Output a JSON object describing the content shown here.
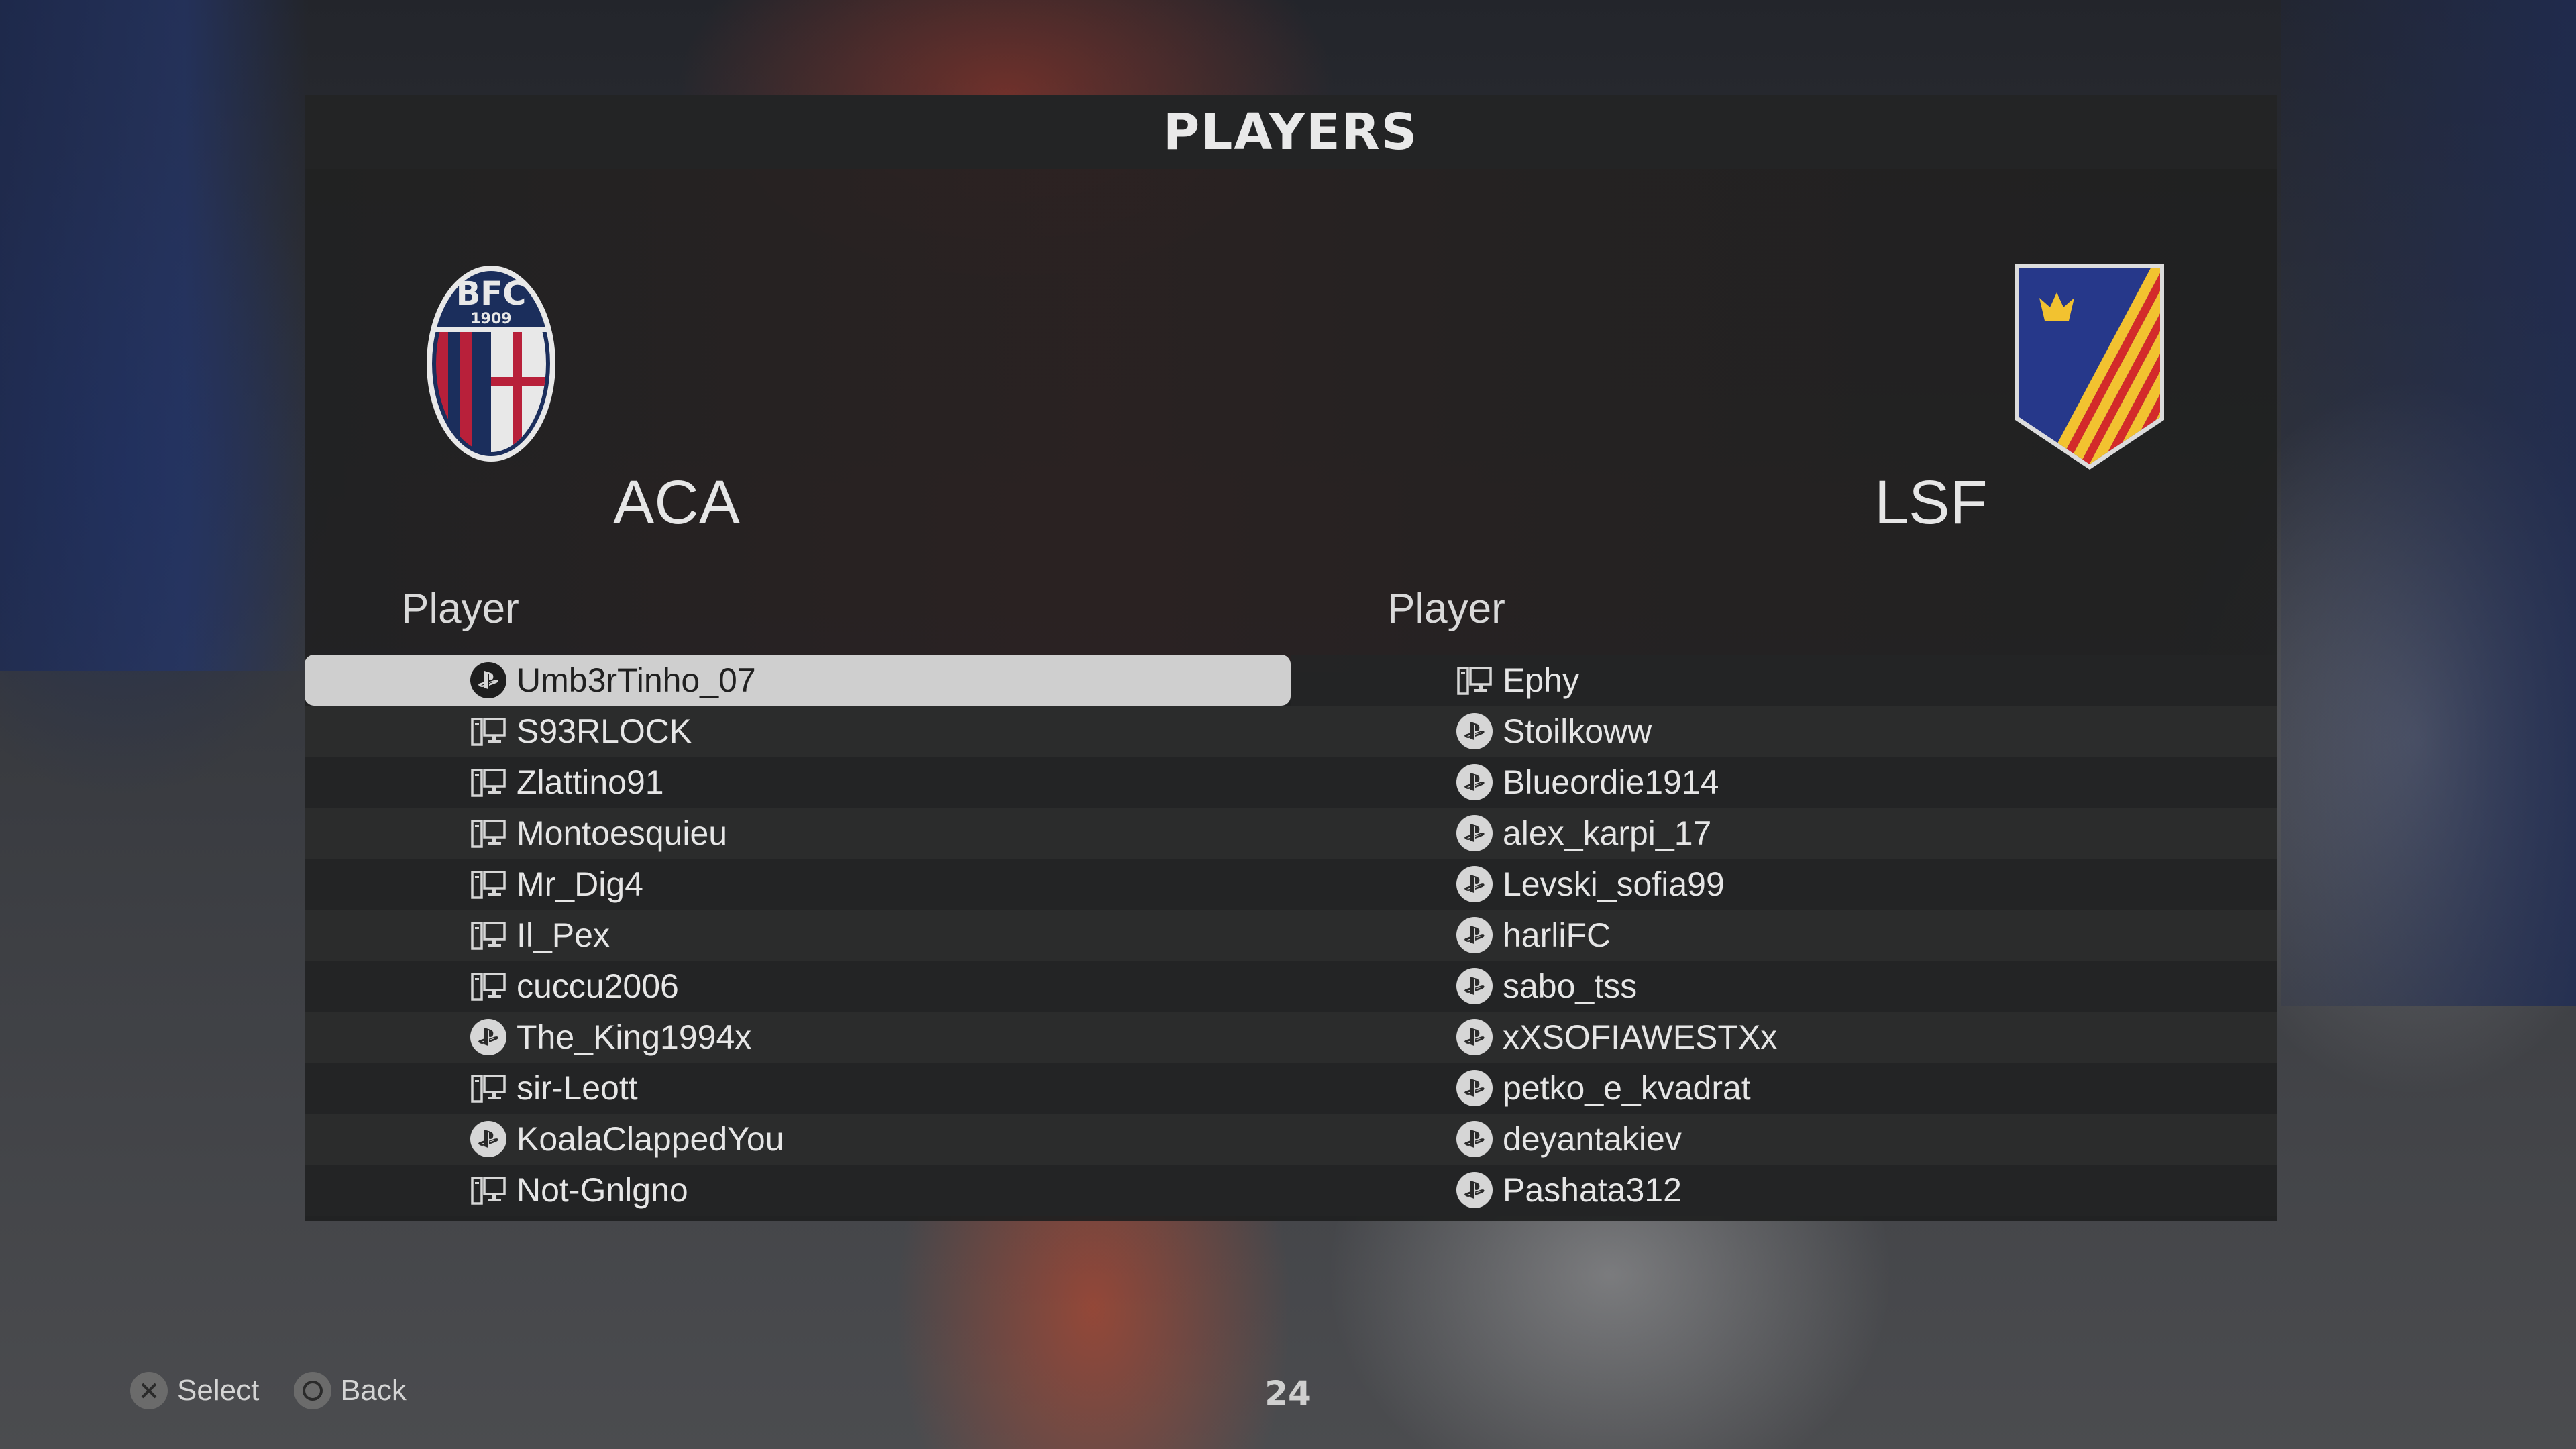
{
  "header": {
    "title": "PLAYERS"
  },
  "teams": {
    "left": {
      "name": "ACA",
      "crest": "bologna-fc-crest-icon",
      "crest_text": "BFC",
      "crest_year": "1909"
    },
    "right": {
      "name": "LSF",
      "crest": "shield-crown-stripes-crest-icon"
    }
  },
  "columns": {
    "left_header": "Player",
    "right_header": "Player"
  },
  "left_players": [
    {
      "name": "Umb3rTinho_07",
      "platform": "playstation-icon",
      "selected": true
    },
    {
      "name": "S93RLOCK",
      "platform": "pc-icon"
    },
    {
      "name": "Zlattino91",
      "platform": "pc-icon"
    },
    {
      "name": "Montoesquieu",
      "platform": "pc-icon"
    },
    {
      "name": "Mr_Dig4",
      "platform": "pc-icon"
    },
    {
      "name": "Il_Pex",
      "platform": "pc-icon"
    },
    {
      "name": "cuccu2006",
      "platform": "pc-icon"
    },
    {
      "name": "The_King1994x",
      "platform": "playstation-icon"
    },
    {
      "name": "sir-Leott",
      "platform": "pc-icon"
    },
    {
      "name": "KoalaClappedYou",
      "platform": "playstation-icon"
    },
    {
      "name": "Not-Gnlgno",
      "platform": "pc-icon"
    }
  ],
  "right_players": [
    {
      "name": "Ephy",
      "platform": "pc-icon"
    },
    {
      "name": "Stoilkoww",
      "platform": "playstation-icon"
    },
    {
      "name": "Blueordie1914",
      "platform": "playstation-icon"
    },
    {
      "name": "alex_karpi_17",
      "platform": "playstation-icon"
    },
    {
      "name": "Levski_sofia99",
      "platform": "playstation-icon"
    },
    {
      "name": "harliFC",
      "platform": "playstation-icon"
    },
    {
      "name": "sabo_tss",
      "platform": "playstation-icon"
    },
    {
      "name": "xXSOFIAWESTXx",
      "platform": "playstation-icon"
    },
    {
      "name": "petko_e_kvadrat",
      "platform": "playstation-icon"
    },
    {
      "name": "deyantakiev",
      "platform": "playstation-icon"
    },
    {
      "name": "Pashata312",
      "platform": "playstation-icon"
    }
  ],
  "footer": {
    "select_label": "Select",
    "select_icon": "cross-button-icon",
    "back_label": "Back",
    "back_icon": "circle-button-icon",
    "page_number": "24"
  },
  "colors": {
    "selected_row": "#cfcfcf",
    "bologna_red": "#b8203a",
    "bologna_blue": "#1b2e5c",
    "lsf_blue": "#26388a",
    "lsf_yellow": "#f2c230",
    "lsf_red": "#d32a2a"
  }
}
